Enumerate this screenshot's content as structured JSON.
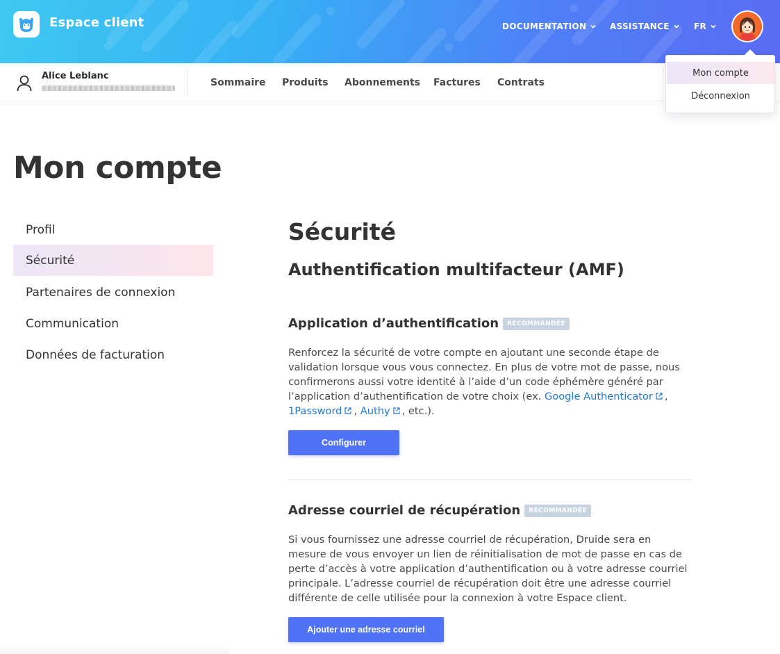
{
  "header": {
    "brand": "Espace client",
    "nav": [
      {
        "label": "DOCUMENTATION"
      },
      {
        "label": "ASSISTANCE"
      },
      {
        "label": "FR"
      }
    ]
  },
  "account_menu": {
    "items": [
      {
        "label": "Mon compte",
        "active": true
      },
      {
        "label": "Déconnexion",
        "active": false
      }
    ]
  },
  "user": {
    "name": "Alice Leblanc"
  },
  "subnav": {
    "links": [
      {
        "label": "Sommaire"
      },
      {
        "label": "Produits"
      },
      {
        "label": "Abonnements"
      },
      {
        "label": "Factures"
      },
      {
        "label": "Contrats"
      }
    ]
  },
  "page": {
    "title": "Mon compte"
  },
  "sidebar": {
    "items": [
      {
        "label": "Profil",
        "active": false
      },
      {
        "label": "Sécurité",
        "active": true
      },
      {
        "label": "Partenaires de connexion",
        "active": false
      },
      {
        "label": "Communication",
        "active": false
      },
      {
        "label": "Données de facturation",
        "active": false
      }
    ]
  },
  "security": {
    "title": "Sécurité",
    "mfa_title": "Authentification multifacteur (AMF)",
    "auth_app": {
      "title": "Application d’authentification",
      "badge": "RECOMMANDÉE",
      "text_1": "Renforcez la sécurité de votre compte en ajoutant une seconde étape de validation lorsque vous vous connectez. En plus de votre mot de passe, nous confirmerons aussi votre identité à l’aide d’un code éphémère généré par l’application d’authentification de votre choix (ex. ",
      "link_google": "Google Authenticator",
      "sep_1": ", ",
      "link_1password": "1Password",
      "sep_2": ", ",
      "link_authy": "Authy",
      "text_end": ", etc.).",
      "button": "Configurer"
    },
    "recovery_email": {
      "title": "Adresse courriel de récupération",
      "badge": "RECOMMANDÉE",
      "text": "Si vous fournissez une adresse courriel de récupération, Druide sera en mesure de vous envoyer un lien de réinitialisation de mot de passe en cas de perte d’accès à votre application d’authentification ou à votre adresse courriel principale. L’adresse courriel de récupération doit être une adresse courriel différente de celle utilisée pour la connexion à votre Espace client.",
      "button": "Ajouter une adresse courriel"
    }
  },
  "colors": {
    "primary_button": "#4f72f6",
    "link": "#1f78d1",
    "badge_bg": "#c9d4e3",
    "avatar_bg": "#f26b2c"
  },
  "icons": {
    "logo": "druide-logo-icon",
    "chevron": "chevron-down-icon",
    "avatar": "avatar-icon",
    "user": "user-icon",
    "external": "external-link-icon"
  }
}
